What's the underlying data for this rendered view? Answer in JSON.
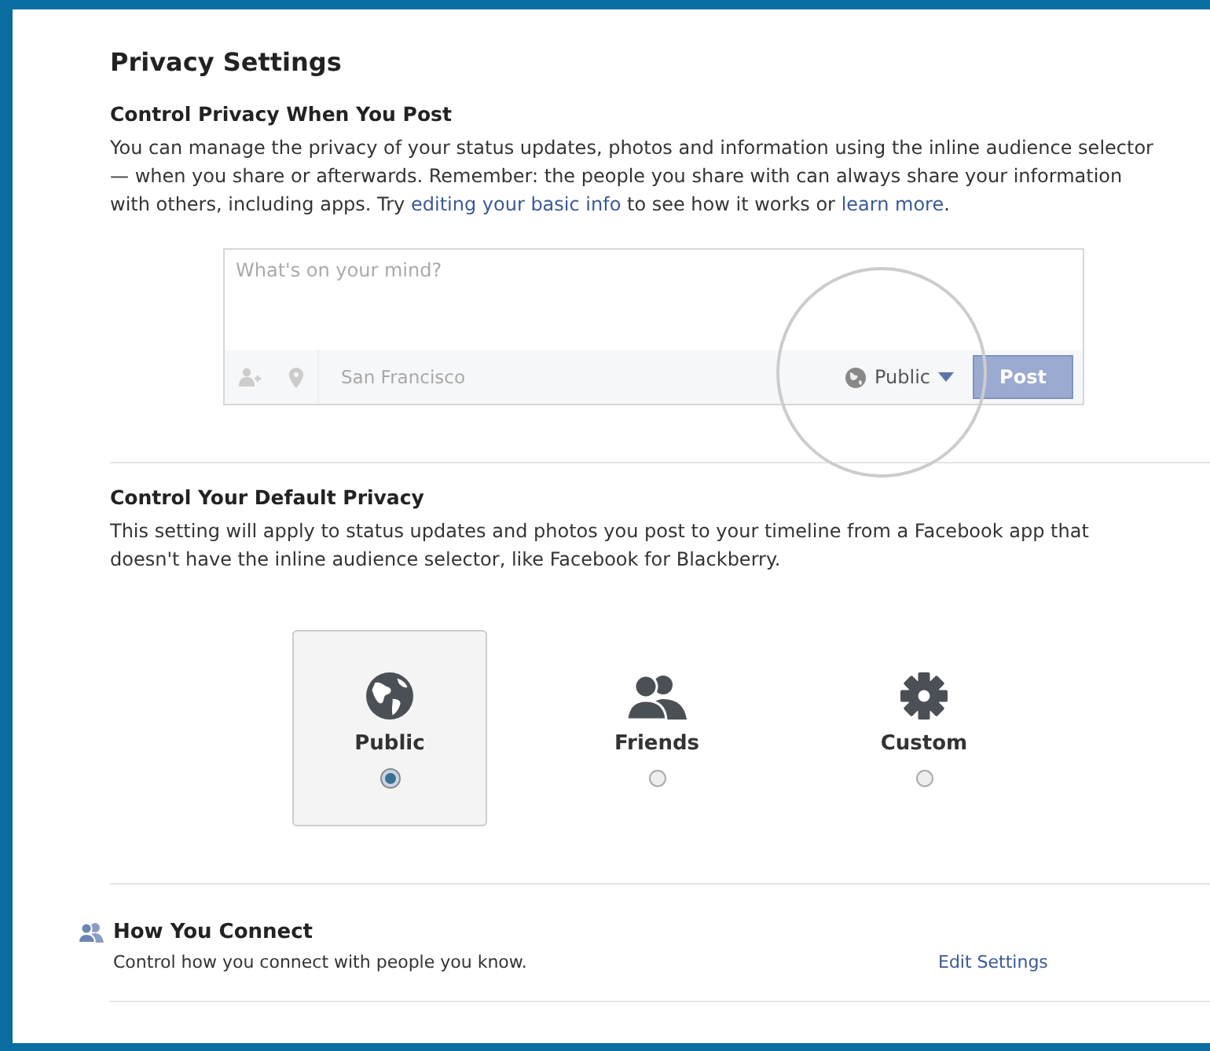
{
  "title": "Privacy Settings",
  "post_section": {
    "heading": "Control Privacy When You Post",
    "description": [
      {
        "kind": "text",
        "text": "You can manage the privacy of your status updates, photos and information using the inline audience selector — when you share or afterwards. Remember: the people you share with can always share your information with others, including apps. Try "
      },
      {
        "kind": "link",
        "text": "editing your basic info"
      },
      {
        "kind": "text",
        "text": " to see how it works or "
      },
      {
        "kind": "link",
        "text": "learn more"
      },
      {
        "kind": "text",
        "text": "."
      }
    ],
    "composer": {
      "placeholder": "What's on your mind?",
      "location_placeholder": "San Francisco",
      "audience": "Public",
      "post_button": "Post"
    }
  },
  "default_section": {
    "heading": "Control Your Default Privacy",
    "description": "This setting will apply to status updates and photos you post to your timeline from a Facebook app that doesn't have the inline audience selector, like Facebook for Blackberry.",
    "options": [
      {
        "label": "Public",
        "kind": "globe",
        "selected": true
      },
      {
        "label": "Friends",
        "kind": "people",
        "selected": false
      },
      {
        "label": "Custom",
        "kind": "gear",
        "selected": false
      }
    ]
  },
  "connect_section": {
    "heading": "How You Connect",
    "description": "Control how you connect with people you know.",
    "link": "Edit Settings"
  }
}
